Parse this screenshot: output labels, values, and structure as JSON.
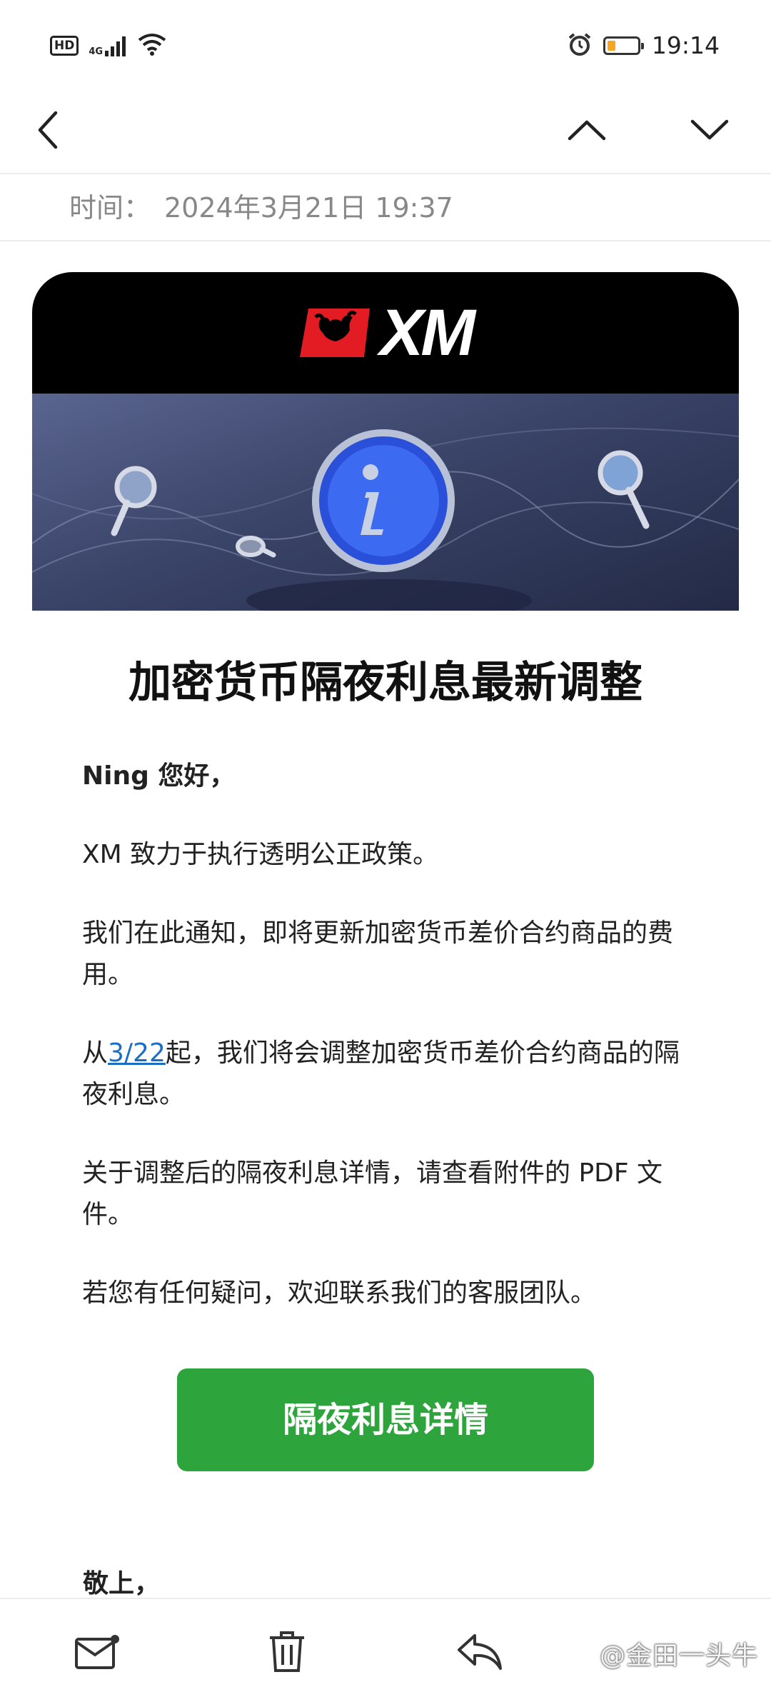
{
  "status_bar": {
    "left_icons": [
      "hd-icon",
      "signal-4g-icon",
      "wifi-icon"
    ],
    "hd_label": "HD",
    "network_label": "4G",
    "right_icons": [
      "alarm-icon",
      "battery-icon"
    ],
    "time": "19:14",
    "battery_level": 0.25,
    "battery_color": "#f5a623"
  },
  "nav": {
    "icons": [
      "back-icon",
      "chevron-up-icon",
      "chevron-down-icon"
    ]
  },
  "meta": {
    "time_label": "时间：",
    "time_value": "2024年3月21日 19:37"
  },
  "email": {
    "brand": "XM",
    "headline": "加密货币隔夜利息最新调整",
    "greeting": "Ning 您好，",
    "p1": "XM 致力于执行透明公正政策。",
    "p2": "我们在此通知，即将更新加密货币差价合约商品的费用。",
    "p3_prefix": "从",
    "p3_link": "3/22",
    "p3_suffix": "起，我们将会调整加密货币差价合约商品的隔夜利息。",
    "p4": "关于调整后的隔夜利息详情，请查看附件的 PDF 文件。",
    "p5": "若您有任何疑问，欢迎联系我们的客服团队。",
    "cta_label": "隔夜利息详情",
    "cta_color": "#2ea43d",
    "signoff": "敬上，"
  },
  "bottom_bar": {
    "icons": [
      "mail-icon",
      "trash-icon",
      "reply-icon"
    ],
    "watermark": "@金田一头牛"
  }
}
